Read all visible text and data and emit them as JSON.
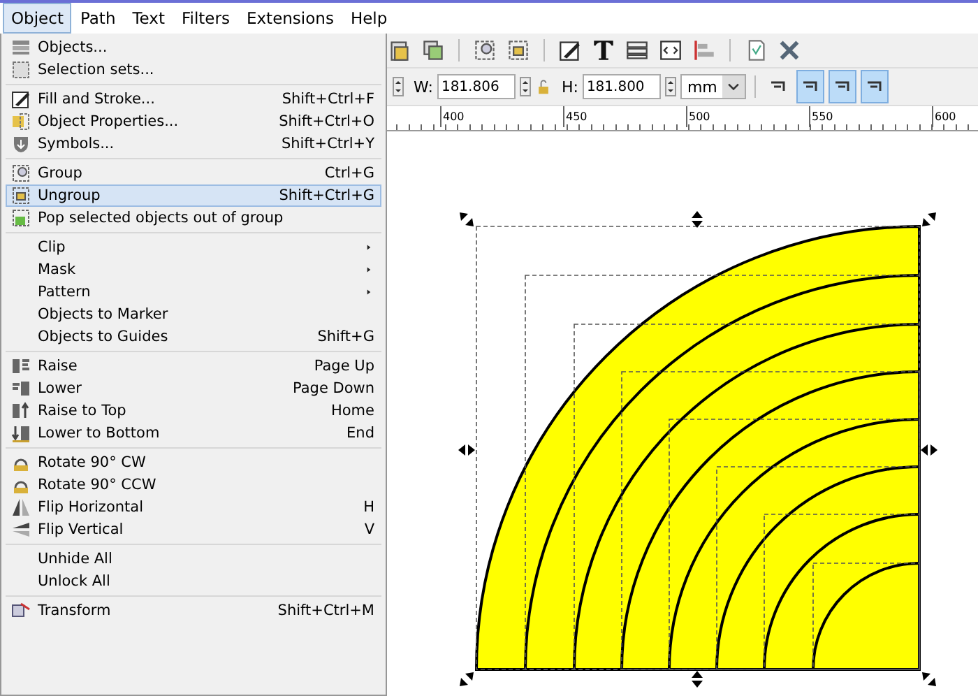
{
  "menubar": [
    {
      "label": "Object",
      "selected": true
    },
    {
      "label": "Path",
      "selected": false
    },
    {
      "label": "Text",
      "selected": false
    },
    {
      "label": "Filters",
      "selected": false
    },
    {
      "label": "Extensions",
      "selected": false
    },
    {
      "label": "Help",
      "selected": false
    }
  ],
  "menu": [
    {
      "kind": "item",
      "label": "Objects...",
      "selected": false
    },
    {
      "kind": "item",
      "label": "Selection sets...",
      "selected": false
    },
    {
      "kind": "separator"
    },
    {
      "kind": "item",
      "label": "Fill and Stroke...",
      "shortcut": "Shift+Ctrl+F",
      "selected": false
    },
    {
      "kind": "item",
      "label": "Object Properties...",
      "shortcut": "Shift+Ctrl+O",
      "selected": false
    },
    {
      "kind": "item",
      "label": "Symbols...",
      "shortcut": "Shift+Ctrl+Y",
      "selected": false
    },
    {
      "kind": "separator"
    },
    {
      "kind": "item",
      "label": "Group",
      "shortcut": "Ctrl+G",
      "selected": false
    },
    {
      "kind": "item",
      "label": "Ungroup",
      "shortcut": "Shift+Ctrl+G",
      "selected": true
    },
    {
      "kind": "item",
      "label": "Pop selected objects out of group",
      "selected": false
    },
    {
      "kind": "separator"
    },
    {
      "kind": "submenu",
      "label": "Clip",
      "selected": false
    },
    {
      "kind": "submenu",
      "label": "Mask",
      "selected": false
    },
    {
      "kind": "submenu",
      "label": "Pattern",
      "selected": false
    },
    {
      "kind": "item",
      "label": "Objects to Marker",
      "selected": false
    },
    {
      "kind": "item",
      "label": "Objects to Guides",
      "shortcut": "Shift+G",
      "selected": false
    },
    {
      "kind": "separator"
    },
    {
      "kind": "item",
      "label": "Raise",
      "shortcut": "Page Up",
      "selected": false
    },
    {
      "kind": "item",
      "label": "Lower",
      "shortcut": "Page Down",
      "selected": false
    },
    {
      "kind": "item",
      "label": "Raise to Top",
      "shortcut": "Home",
      "selected": false
    },
    {
      "kind": "item",
      "label": "Lower to Bottom",
      "shortcut": "End",
      "selected": false
    },
    {
      "kind": "separator"
    },
    {
      "kind": "item",
      "label": "Rotate 90° CW",
      "selected": false
    },
    {
      "kind": "item",
      "label": "Rotate 90° CCW",
      "selected": false
    },
    {
      "kind": "item",
      "label": "Flip Horizontal",
      "shortcut": "H",
      "selected": false
    },
    {
      "kind": "item",
      "label": "Flip Vertical",
      "shortcut": "V",
      "selected": false
    },
    {
      "kind": "separator"
    },
    {
      "kind": "item",
      "label": "Unhide All",
      "selected": false
    },
    {
      "kind": "item",
      "label": "Unlock All",
      "selected": false
    },
    {
      "kind": "separator"
    },
    {
      "kind": "item",
      "label": "Transform",
      "shortcut": "Shift+Ctrl+M",
      "selected": false
    }
  ],
  "toolbar": {
    "width_label": "W:",
    "width_value": "181.806",
    "height_label": "H:",
    "height_value": "181.800",
    "unit": "mm",
    "scale_buttons": [
      {
        "selected": false
      },
      {
        "selected": true
      },
      {
        "selected": true
      },
      {
        "selected": true
      }
    ]
  },
  "ruler": [
    "400",
    "450",
    "500",
    "550",
    "600"
  ]
}
